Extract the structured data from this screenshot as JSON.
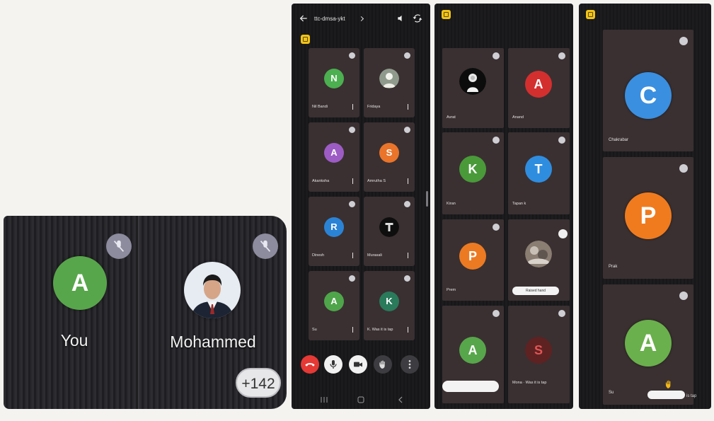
{
  "call_grid": {
    "tiles": [
      {
        "name": "You",
        "initial": "A",
        "color": "#58a64b"
      },
      {
        "name": "Mohammed"
      }
    ],
    "overflow_count": "+142",
    "icons": [
      "mic-off-icon",
      "participant-photo"
    ]
  },
  "phone_grid": {
    "meeting_code": "ttc-dmsa-ykt",
    "icons": [
      "arrow-left-icon",
      "chevron-right-icon",
      "speaker-icon",
      "switch-camera-icon",
      "meeting-badge-icon"
    ],
    "tiles": [
      {
        "name": "Nil Bandi",
        "initial": "N",
        "color": "#4caf50"
      },
      {
        "name": "Fridaya"
      },
      {
        "name": "Akanksha",
        "initial": "A",
        "color": "#9c5cc4"
      },
      {
        "name": "Amrutha S",
        "initial": "S",
        "color": "#e9742a"
      },
      {
        "name": "Dinesh",
        "initial": "R",
        "color": "#2b83d6"
      },
      {
        "name": "Murasali"
      },
      {
        "name": "Su",
        "initial": "A",
        "color": "#4fa54a"
      },
      {
        "name": "K. Was it is tap",
        "initial": "K",
        "color": "#2a7a5c"
      }
    ],
    "controls": [
      {
        "icon": "end-call-icon",
        "color": "#e53935"
      },
      {
        "icon": "microphone-icon",
        "color": "#f1f1f1"
      },
      {
        "icon": "camera-icon",
        "color": "#f1f1f1"
      },
      {
        "icon": "raise-hand-icon",
        "color": "#3d3d41"
      },
      {
        "icon": "more-options-icon",
        "color": "#3d3d41"
      }
    ]
  },
  "phone_list": {
    "icons": [
      "meeting-badge-icon",
      "raise-hand-icon"
    ],
    "tiles": [
      {
        "name": "Avrat"
      },
      {
        "name": "Anand",
        "initial": "A",
        "color": "#d32f2f"
      },
      {
        "name": "Kiran",
        "initial": "K",
        "color": "#4a9a3a"
      },
      {
        "name": "Tapan k",
        "initial": "T",
        "color": "#2f8de0"
      },
      {
        "name": "Prem",
        "initial": "P",
        "color": "#ec7a22"
      },
      {
        "status": "Raised hand"
      },
      {
        "initial": "A",
        "color": "#58a64b"
      },
      {
        "name": "Mona · Was it is tap",
        "initial": "S",
        "color": "#5e2222"
      }
    ]
  },
  "phone_spotlight": {
    "icons": [
      "meeting-badge-icon",
      "raise-hand-icon"
    ],
    "tiles": [
      {
        "name": "Chakrabar",
        "initial": "C",
        "color": "#3a8fe0"
      },
      {
        "name": "Prak",
        "initial": "P",
        "color": "#f07b1e"
      },
      {
        "name": "Su",
        "initial": "A",
        "color": "#6ab04c"
      }
    ],
    "status_suffix": "is tap"
  }
}
